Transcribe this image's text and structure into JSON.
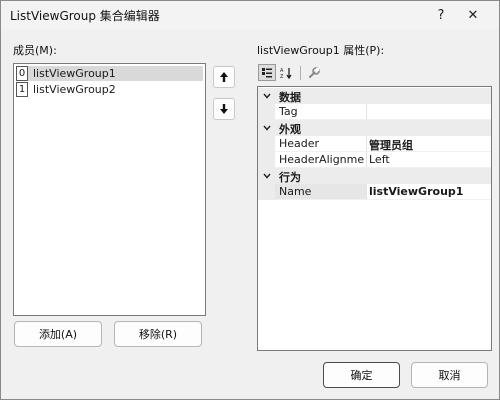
{
  "dialog": {
    "title": "ListViewGroup 集合编辑器",
    "help_glyph": "?",
    "close_glyph": "✕"
  },
  "members": {
    "label": "成员(M):",
    "items": [
      {
        "index": "0",
        "text": "listViewGroup1",
        "selected": true
      },
      {
        "index": "1",
        "text": "listViewGroup2",
        "selected": false
      }
    ],
    "move_up_icon": "arrow-up-icon",
    "move_down_icon": "arrow-down-icon",
    "add_label": "添加(A)",
    "remove_label": "移除(R)"
  },
  "properties": {
    "label": "listViewGroup1 属性(P):",
    "toolbar": [
      "categorized-icon",
      "alphabetical-icon",
      "property-pages-icon"
    ],
    "categories": [
      {
        "name": "数据",
        "props": [
          {
            "name": "Tag",
            "value": "",
            "bold": false
          }
        ]
      },
      {
        "name": "外观",
        "props": [
          {
            "name": "Header",
            "value": "管理员组",
            "bold": true
          },
          {
            "name": "HeaderAlignmen",
            "value": "Left",
            "bold": false
          }
        ]
      },
      {
        "name": "行为",
        "props": [
          {
            "name": "Name",
            "value": "listViewGroup1",
            "bold": true
          }
        ]
      }
    ]
  },
  "footer": {
    "ok_label": "确定",
    "cancel_label": "取消"
  }
}
